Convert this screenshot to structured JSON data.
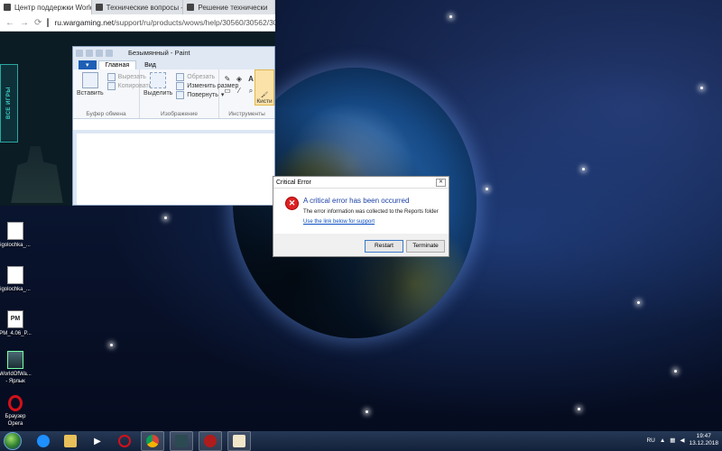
{
  "browser": {
    "tabs": [
      {
        "label": "Центр поддержки World of Wa"
      },
      {
        "label": "Технические вопросы - Офиц"
      },
      {
        "label": "Решение технически"
      }
    ],
    "url_host": "ru.wargaming.net",
    "url_path": "/support/ru/products/wows/help/30560/30562/30564/",
    "side_button": "ВСЕ ИГРЫ"
  },
  "paint": {
    "title": "Безымянный - Paint",
    "tabs": {
      "home": "Главная",
      "view": "Вид"
    },
    "clipboard": {
      "paste": "Вставить",
      "cut": "Вырезать",
      "copy": "Копировать",
      "group": "Буфер обмена"
    },
    "image": {
      "select": "Выделить",
      "crop": "Обрезать",
      "resize": "Изменить размер",
      "rotate": "Повернуть",
      "group": "Изображение"
    },
    "tools": {
      "group": "Инструменты",
      "text_tool": "A"
    },
    "brushes": "Кисти"
  },
  "dialog": {
    "title": "Critical Error",
    "heading": "A critical error has been occurred",
    "message": "The error information was collected to the Reports folder",
    "link": "Use the link below for support",
    "restart": "Restart",
    "terminate": "Terminate"
  },
  "desktop_icons": [
    {
      "label": "igolochka_..."
    },
    {
      "label": "igolochka_..."
    },
    {
      "label": "PM_4.06_P..."
    },
    {
      "label": "WorldOfWa... - Ярлык"
    },
    {
      "label": "Браузер Opera"
    }
  ],
  "taskbar": {
    "language": "RU",
    "time": "19:47",
    "date": "13.12.2018"
  },
  "colors": {
    "dialog_heading": "#1a3fa5",
    "error_icon": "#dd2222",
    "link": "#0b4fc0",
    "paint_file_tab": "#1d5fb5"
  }
}
